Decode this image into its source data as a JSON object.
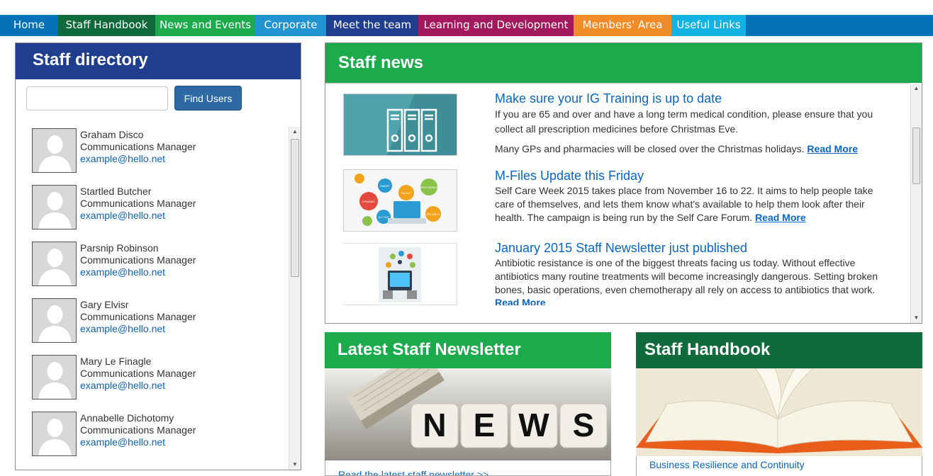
{
  "nav": [
    {
      "label": "Home",
      "color": "#0572b8"
    },
    {
      "label": "Staff Handbook",
      "color": "#116a3c"
    },
    {
      "label": "News and Events",
      "color": "#1cab4c"
    },
    {
      "label": "Corporate",
      "color": "#2094d1"
    },
    {
      "label": "Meet the team",
      "color": "#1f3f8e"
    },
    {
      "label": "Learning and Development",
      "color": "#a3195b"
    },
    {
      "label": "Members' Area",
      "color": "#f28c28"
    },
    {
      "label": "Useful Links",
      "color": "#12b2e3"
    }
  ],
  "directory": {
    "title": "Staff directory",
    "search_value": "",
    "search_button": "Find Users",
    "people": [
      {
        "name": "Graham Disco",
        "role": "Communications Manager",
        "email": "example@hello.net"
      },
      {
        "name": "Startled Butcher",
        "role": "Communications Manager",
        "email": "example@hello.net"
      },
      {
        "name": "Parsnip Robinson",
        "role": "Communications Manager",
        "email": "example@hello.net"
      },
      {
        "name": "Gary Elvisr",
        "role": "Communications Manager",
        "email": "example@hello.net"
      },
      {
        "name": "Mary Le Finagle",
        "role": "Communications Manager",
        "email": "example@hello.net"
      },
      {
        "name": "Annabelle Dichotomy",
        "role": "Communications Manager",
        "email": "example@hello.net"
      }
    ]
  },
  "news": {
    "title": "Staff news",
    "read_more": "Read More",
    "items": [
      {
        "title": "Make sure your IG Training is up to date",
        "body": "If you are 65 and over and have a long term medical condition, please ensure that you collect all prescription medicines before Christmas Eve.",
        "body2": "Many GPs and pharmacies will be closed over the Christmas holidays."
      },
      {
        "title": "M-Files Update this Friday",
        "body": "Self Care Week 2015 takes place from November 16 to 22. It aims to help people take care of themselves, and lets them know what's available to help them look after their health. The campaign is being run by the Self Care Forum."
      },
      {
        "title": "January 2015 Staff Newsletter just published",
        "body": "Antibiotic resistance is one of the biggest threats facing us today. Without effective antibiotics many routine treatments will become increasingly dangerous. Setting broken bones, basic operations, even chemotherapy all rely on access to antibiotics that work."
      }
    ],
    "image_words": [
      "SMART",
      "ACTIVE",
      "TALENT",
      "RESPONSIBLE",
      "DYNAMIC",
      "PRUDENT"
    ]
  },
  "newsletter": {
    "title": "Latest Staff Newsletter",
    "image_text": "NEWS",
    "link": "Read the latest staff newsletter >>"
  },
  "handbook": {
    "title": "Staff Handbook",
    "link": "Business Resilience and Continuity"
  }
}
